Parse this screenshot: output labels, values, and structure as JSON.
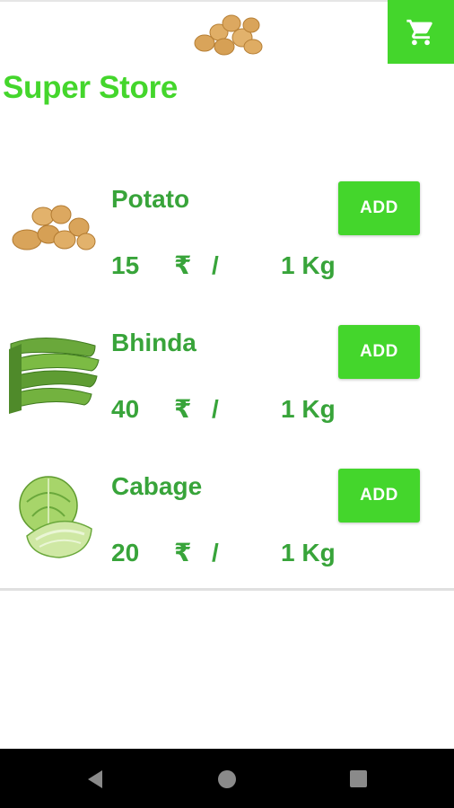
{
  "app": {
    "title": "Super Store",
    "accent_color": "#44d62c",
    "text_color": "#38a43a",
    "header_logo_icon": "potatoes-icon",
    "cart_icon": "shopping-cart-icon"
  },
  "products": [
    {
      "name": "Potato",
      "price": "15",
      "currency": "₹",
      "separator": "/",
      "unit": "1 Kg",
      "button_label": "ADD",
      "image_icon": "potato-image"
    },
    {
      "name": "Bhinda",
      "price": "40",
      "currency": "₹",
      "separator": "/",
      "unit": "1 Kg",
      "button_label": "ADD",
      "image_icon": "okra-image"
    },
    {
      "name": "Cabage",
      "price": "20",
      "currency": "₹",
      "separator": "/",
      "unit": "1 Kg",
      "button_label": "ADD",
      "image_icon": "cabbage-image"
    }
  ],
  "navbar": {
    "back_icon": "back-triangle-icon",
    "home_icon": "home-circle-icon",
    "recents_icon": "recents-square-icon"
  }
}
